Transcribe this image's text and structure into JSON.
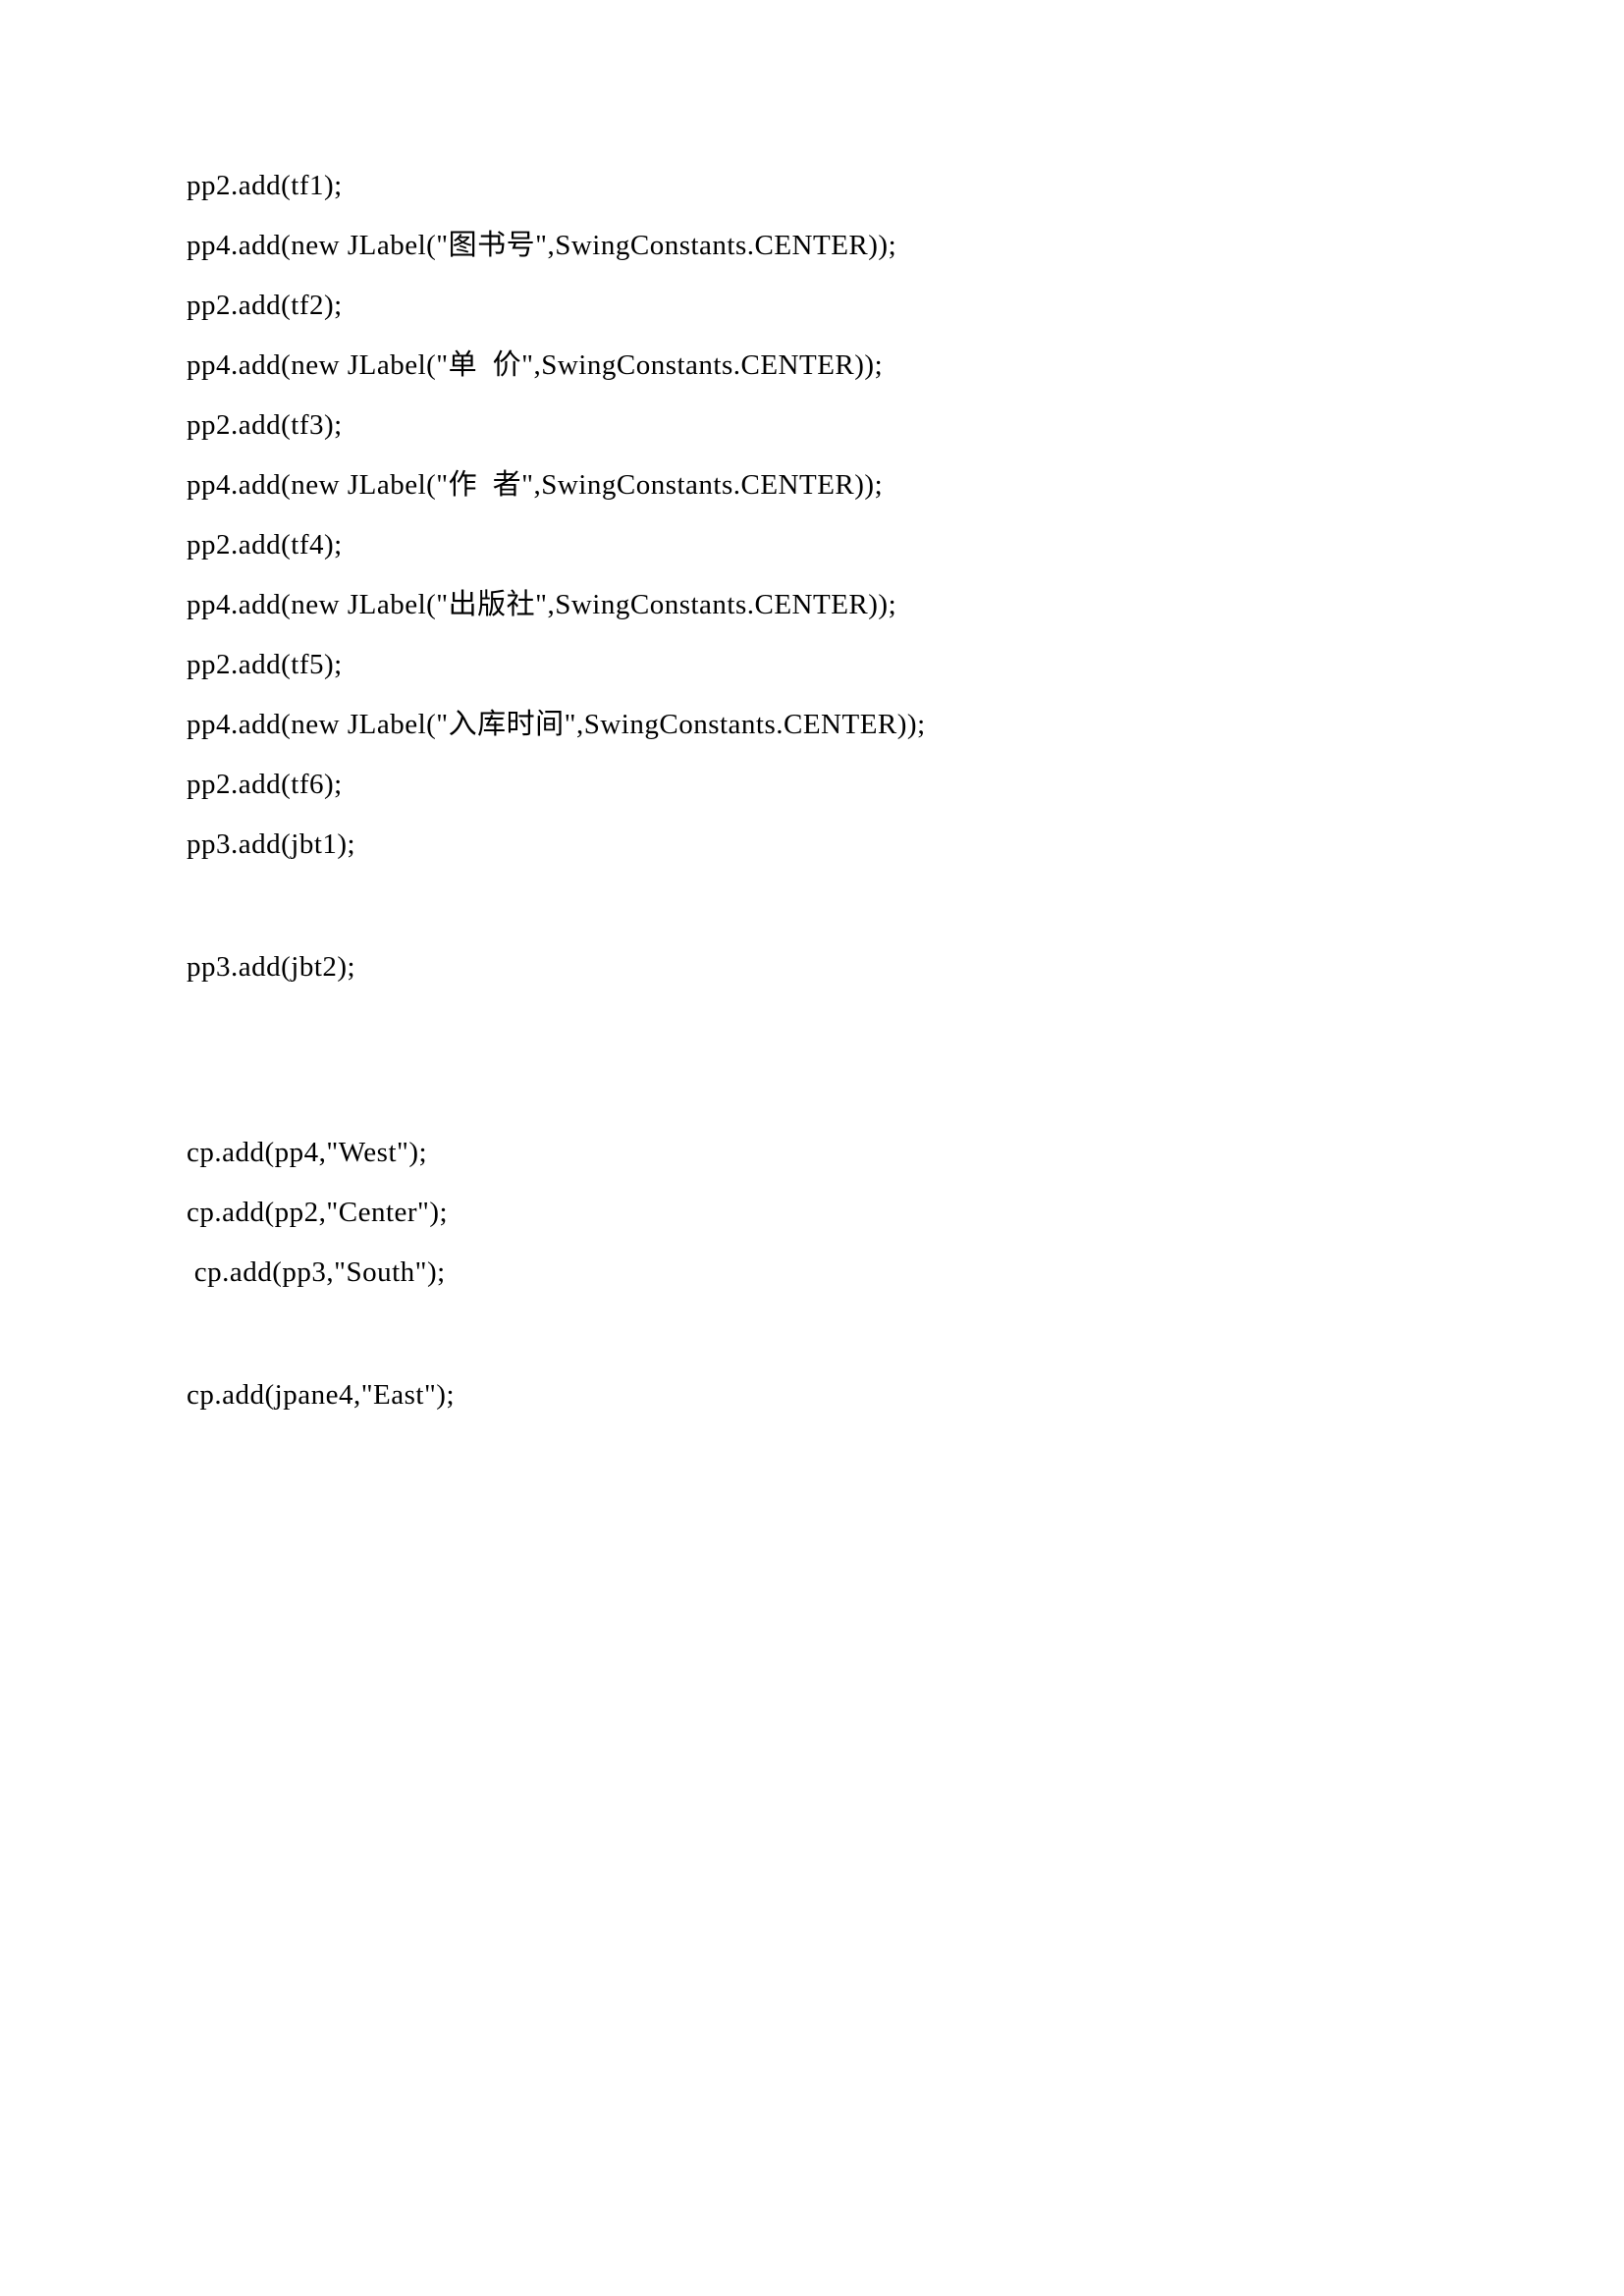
{
  "code": {
    "lines": [
      "pp2.add(tf1);",
      "pp4.add(new JLabel(\"图书号\",SwingConstants.CENTER));",
      "pp2.add(tf2);",
      "pp4.add(new JLabel(\"单  价\",SwingConstants.CENTER));",
      "pp2.add(tf3);",
      "pp4.add(new JLabel(\"作  者\",SwingConstants.CENTER));",
      "pp2.add(tf4);",
      "pp4.add(new JLabel(\"出版社\",SwingConstants.CENTER));",
      "pp2.add(tf5);",
      "pp4.add(new JLabel(\"入库时间\",SwingConstants.CENTER));",
      "pp2.add(tf6);",
      "pp3.add(jbt1);",
      "",
      "pp3.add(jbt2);",
      "",
      "",
      "cp.add(pp4,\"West\");",
      "cp.add(pp2,\"Center\");",
      " cp.add(pp3,\"South\");",
      "",
      "cp.add(jpane4,\"East\");"
    ]
  }
}
